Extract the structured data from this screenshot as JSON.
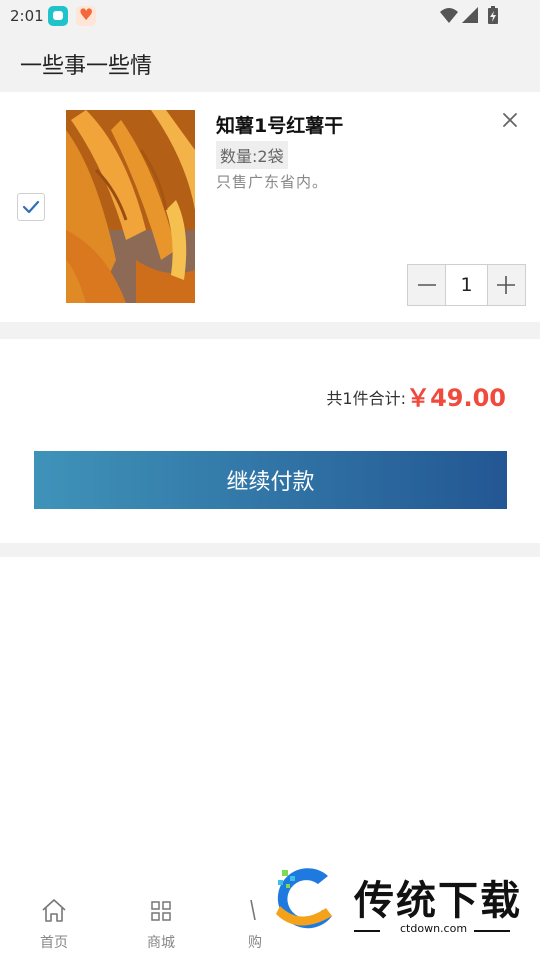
{
  "status_bar": {
    "time": "2:01",
    "icons": [
      "app-notification-icon",
      "heart-app-icon",
      "wifi-icon",
      "signal-icon",
      "battery-icon"
    ]
  },
  "header": {
    "title": "一些事一些情"
  },
  "cart": {
    "items": [
      {
        "checked": true,
        "name": "知薯1号红薯干",
        "spec": "数量:2袋",
        "note": "只售广东省内。",
        "quantity": "1"
      }
    ]
  },
  "summary": {
    "total_label": "共1件合计:",
    "total_value": "￥49.00"
  },
  "pay_button": {
    "label": "继续付款"
  },
  "bottom_nav": {
    "items": [
      {
        "label": "首页",
        "icon": "home-icon"
      },
      {
        "label": "商城",
        "icon": "grid-icon"
      },
      {
        "label": "购",
        "icon": "cart-icon"
      }
    ]
  },
  "watermark": {
    "brand": "传统下载",
    "url": "ctdown.com"
  },
  "colors": {
    "price": "#f14a3c",
    "button_start": "#3f93b9",
    "button_end": "#235793",
    "checkbox_check": "#2f6fb3",
    "background_gray": "#f2f2f2"
  }
}
